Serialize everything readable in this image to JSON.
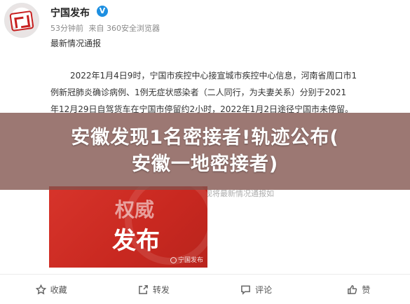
{
  "post": {
    "author": "宁国发布",
    "verified": "V",
    "time": "53分钟前",
    "source": "来自 360安全浏览器",
    "title": "最新情况通报",
    "paragraph": [
      "2022年1月4日9时，宁国市疾控中心接宣城市疾控中心信息，河南省周口市1",
      "例新冠肺炎确诊病例、1例无症状感染者（二人同行，为夫妻关系）分别于2021",
      "年12月29日自驾货车在宁国市停留约2小时，2022年1月2日途径宁国市未停留。"
    ],
    "faded_line": "我市疫情防控指挥部立即启动应急处置预案，现将最新情况通报如"
  },
  "banner": {
    "line1": "安徽发现1名密接者!轨迹公布(",
    "line2": "安徽一地密接者)"
  },
  "image": {
    "word1": "权威",
    "word2": "发布",
    "watermark": "宁国发布"
  },
  "actions": [
    {
      "label": "收藏",
      "icon": "star-icon"
    },
    {
      "label": "转发",
      "icon": "repost-icon"
    },
    {
      "label": "评论",
      "icon": "comment-icon"
    },
    {
      "label": "赞",
      "icon": "thumbs-up-icon"
    }
  ],
  "colors": {
    "banner_overlay": "#80524c",
    "image_red": "#d7342b",
    "verify_blue": "#1d8fe1"
  }
}
